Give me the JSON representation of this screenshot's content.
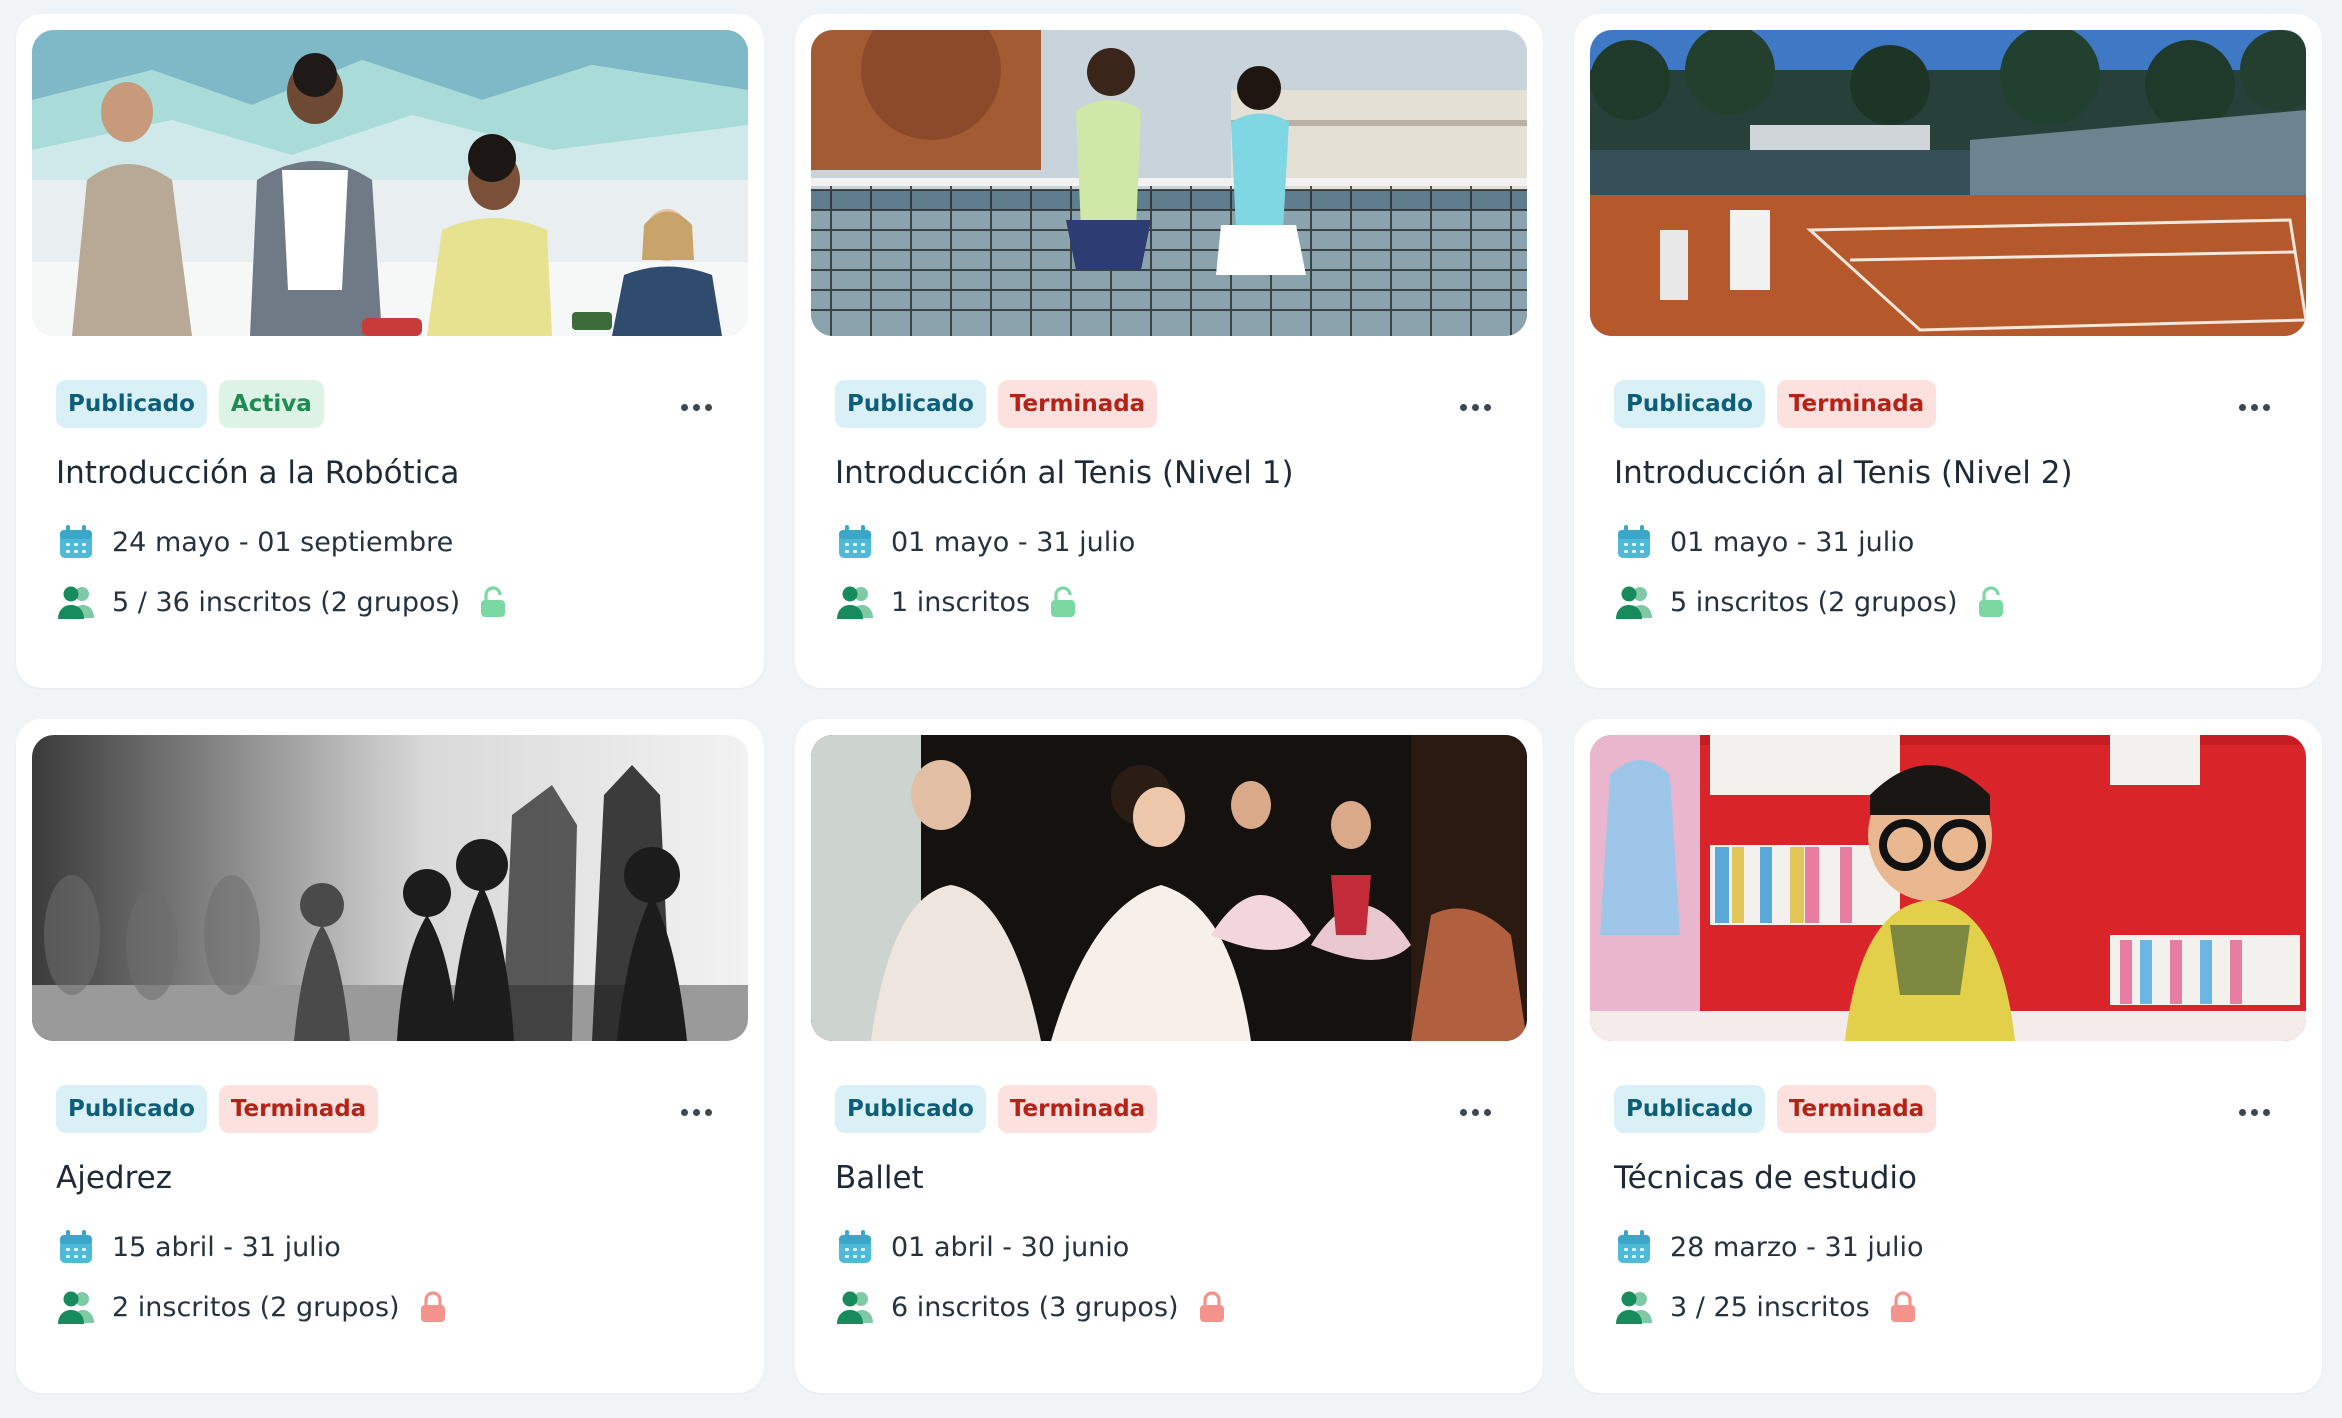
{
  "badge_styles": {
    "Publicado": {
      "bg": "#d9f0f7",
      "fg": "#0f5e78"
    },
    "Activa": {
      "bg": "#dcf3e6",
      "fg": "#1f8a52"
    },
    "Terminada": {
      "bg": "#fde1df",
      "fg": "#b42318"
    }
  },
  "colors": {
    "lock_open": "#7cd8a3",
    "lock_closed": "#f4938b",
    "calendar": "#4fb9d8",
    "user": "#178a5e"
  },
  "courses": [
    {
      "status": "Publicado",
      "state": "Activa",
      "title": "Introducción a la Robótica",
      "dates": "24 mayo - 01 septiembre",
      "enrollment": "5 / 36 inscritos (2 grupos)",
      "lock": "open",
      "image": "robotics-kids-photo"
    },
    {
      "status": "Publicado",
      "state": "Terminada",
      "title": "Introducción al Tenis (Nivel 1)",
      "dates": "01 mayo - 31 julio",
      "enrollment": "1 inscritos",
      "lock": "open",
      "image": "tennis-girls-net-photo"
    },
    {
      "status": "Publicado",
      "state": "Terminada",
      "title": "Introducción al Tenis (Nivel 2)",
      "dates": "01 mayo - 31 julio",
      "enrollment": "5 inscritos (2 grupos)",
      "lock": "open",
      "image": "clay-tennis-court-photo"
    },
    {
      "status": "Publicado",
      "state": "Terminada",
      "title": "Ajedrez",
      "dates": "15 abril - 31 julio",
      "enrollment": "2 inscritos (2 grupos)",
      "lock": "closed",
      "image": "chess-pieces-photo"
    },
    {
      "status": "Publicado",
      "state": "Terminada",
      "title": "Ballet",
      "dates": "01 abril - 30 junio",
      "enrollment": "6 inscritos (3 grupos)",
      "lock": "closed",
      "image": "ballet-dancers-photo"
    },
    {
      "status": "Publicado",
      "state": "Terminada",
      "title": "Técnicas de estudio",
      "dates": "28 marzo - 31 julio",
      "enrollment": "3 / 25 inscritos",
      "lock": "closed",
      "image": "boy-glasses-bookshelf-photo"
    }
  ]
}
